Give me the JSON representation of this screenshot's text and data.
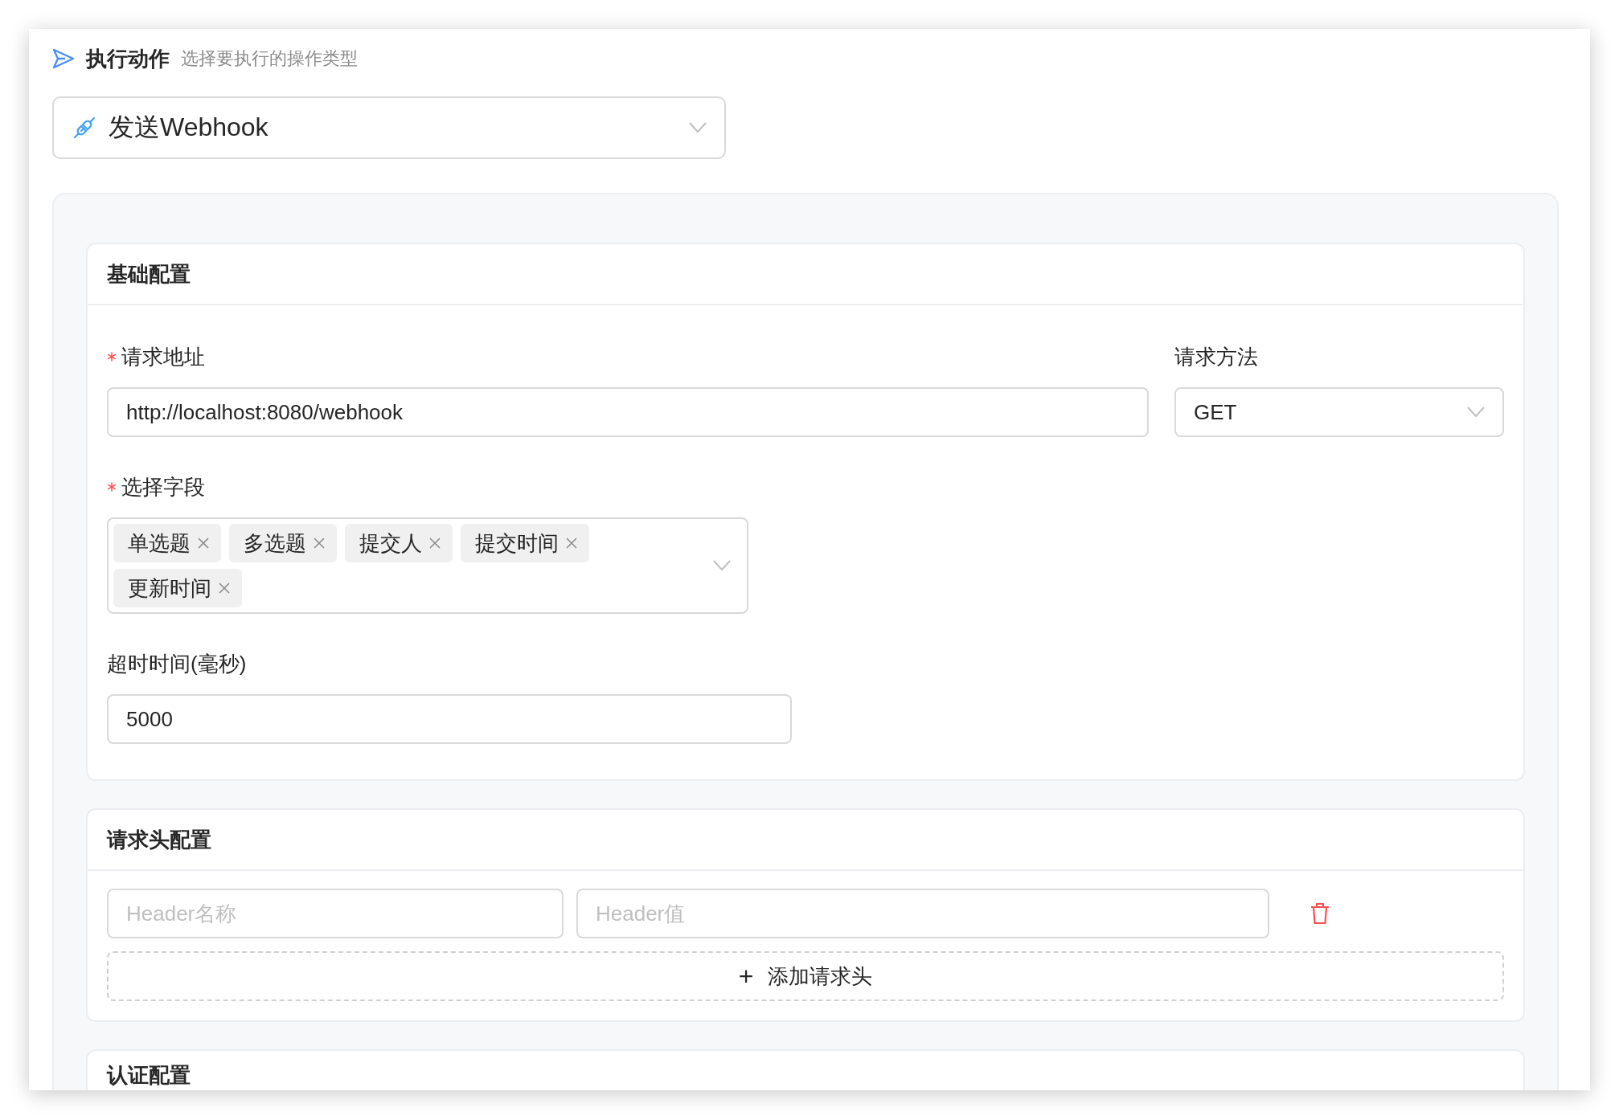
{
  "section": {
    "title": "执行动作",
    "subtitle": "选择要执行的操作类型"
  },
  "action_select": {
    "value": "发送Webhook"
  },
  "cards": [
    {
      "kind": "basic",
      "title": "基础配置",
      "url": {
        "label": "请求地址",
        "required": true,
        "value": "http://localhost:8080/webhook"
      },
      "method": {
        "label": "请求方法",
        "required": false,
        "value": "GET"
      },
      "fields": {
        "label": "选择字段",
        "required": true,
        "tags": [
          "单选题",
          "多选题",
          "提交人",
          "提交时间",
          "更新时间"
        ]
      },
      "timeout": {
        "label": "超时时间(毫秒)",
        "required": false,
        "value": "5000"
      }
    },
    {
      "kind": "headers",
      "title": "请求头配置",
      "rows": [
        {
          "name_placeholder": "Header名称",
          "value_placeholder": "Header值"
        }
      ],
      "add_button": {
        "icon": "+",
        "label": "添加请求头"
      }
    },
    {
      "kind": "auth",
      "title": "认证配置"
    }
  ]
}
